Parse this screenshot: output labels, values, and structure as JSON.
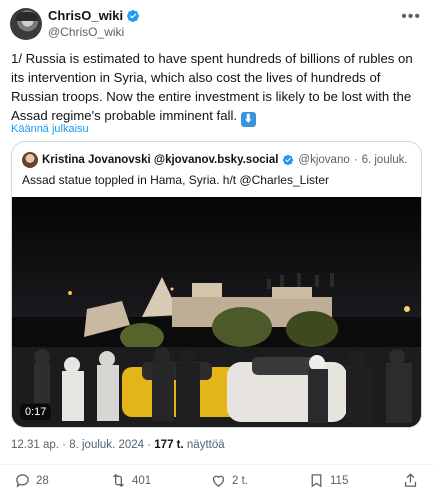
{
  "author": {
    "display_name": "ChrisO_wiki",
    "handle": "@ChrisO_wiki"
  },
  "more_icon": "more-horizontal-icon",
  "tweet": {
    "text": "1/ Russia is estimated to have spent hundreds of billions of rubles on its intervention in Syria, which also cost the lives of hundreds of Russian troops. Now the entire investment is likely to be lost with the Assad regime's probable imminent fall.",
    "emoji": "⬇",
    "translate_label": "Käännä julkaisu"
  },
  "quote": {
    "display_name": "Kristina Jovanovski @kjovanov.bsky.social",
    "handle": "@kjovano",
    "separator": "·",
    "date": "6. jouluk.",
    "text": "Assad statue toppled in Hama, Syria. h/t @Charles_Lister",
    "video_duration": "0:17"
  },
  "meta": {
    "time": "12.31 ap.",
    "separator": "·",
    "date": "8. jouluk. 2024",
    "views_count": "177 t.",
    "views_label": "näyttöä"
  },
  "actions": {
    "replies": "28",
    "reposts": "401",
    "likes": "2 t.",
    "bookmarks": "115"
  },
  "colors": {
    "accent": "#1d9bf0",
    "text": "#0f1419",
    "muted": "#536471",
    "border": "#cfd9de"
  }
}
